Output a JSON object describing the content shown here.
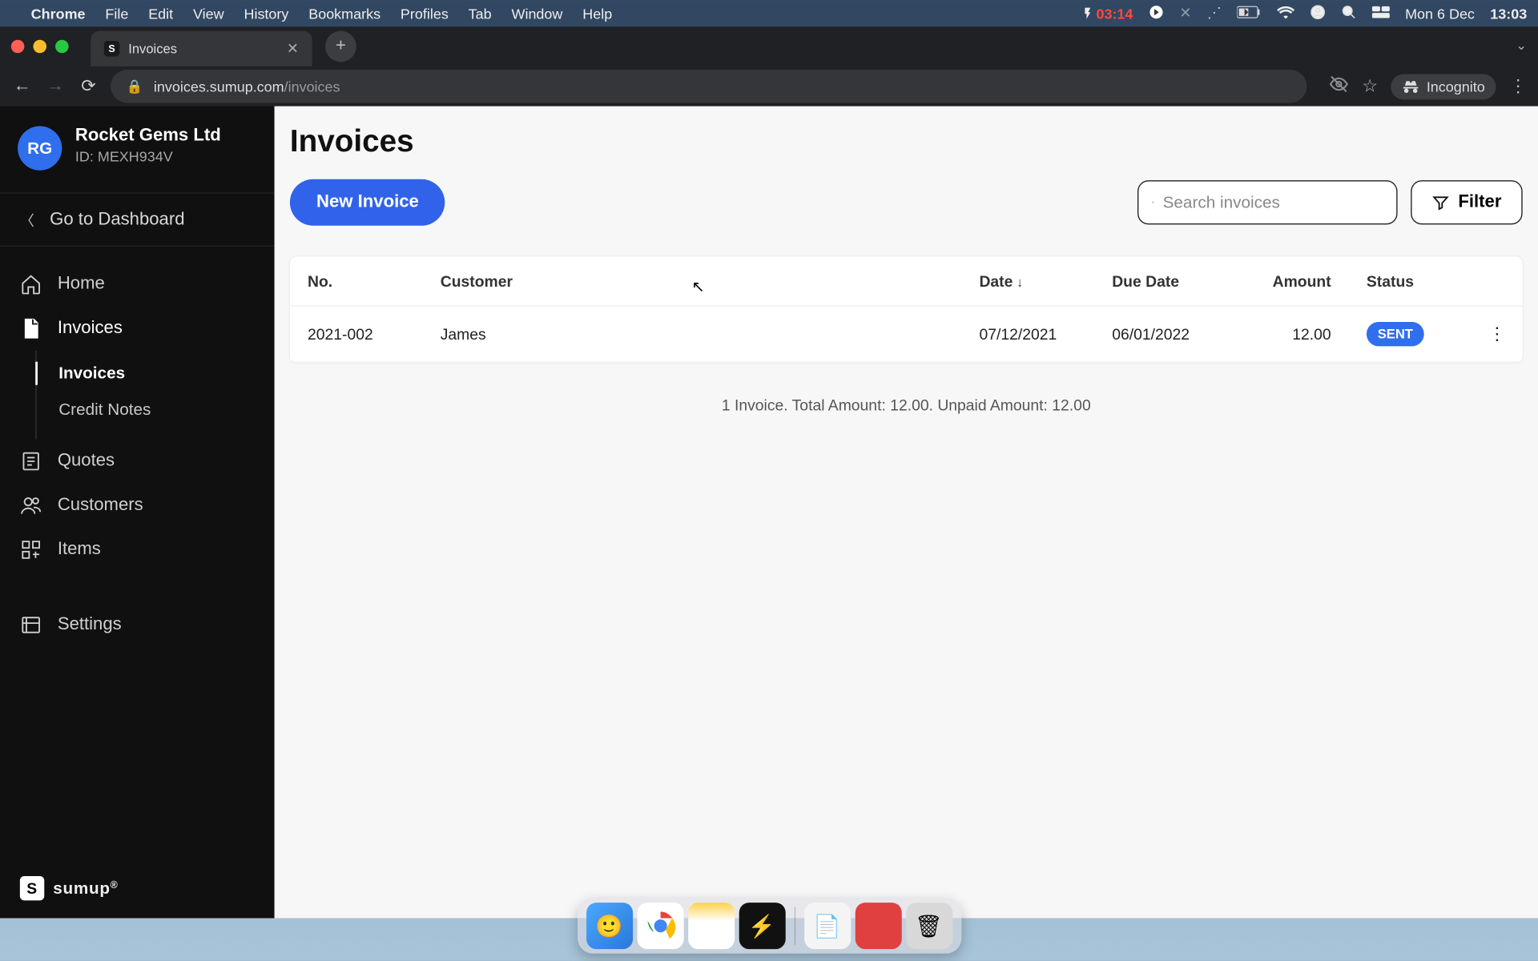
{
  "mac_menu": {
    "app": "Chrome",
    "items": [
      "File",
      "Edit",
      "View",
      "History",
      "Bookmarks",
      "Profiles",
      "Tab",
      "Window",
      "Help"
    ],
    "battery_time": "03:14",
    "date": "Mon 6 Dec",
    "clock": "13:03"
  },
  "browser": {
    "tab_title": "Invoices",
    "url_host": "invoices.sumup.com",
    "url_path": "/invoices",
    "incognito_label": "Incognito"
  },
  "sidebar": {
    "avatar_initials": "RG",
    "company_name": "Rocket Gems Ltd",
    "company_id": "ID: MEXH934V",
    "go_dashboard": "Go to Dashboard",
    "items": [
      {
        "label": "Home"
      },
      {
        "label": "Invoices"
      },
      {
        "label": "Quotes"
      },
      {
        "label": "Customers"
      },
      {
        "label": "Items"
      },
      {
        "label": "Settings"
      }
    ],
    "sub_invoices": {
      "invoices": "Invoices",
      "credit_notes": "Credit Notes"
    },
    "brand": "sumup"
  },
  "page": {
    "title": "Invoices",
    "new_invoice": "New Invoice",
    "search_placeholder": "Search invoices",
    "filter": "Filter"
  },
  "table": {
    "headers": {
      "no": "No.",
      "customer": "Customer",
      "date": "Date",
      "due_date": "Due Date",
      "amount": "Amount",
      "status": "Status"
    },
    "rows": [
      {
        "no": "2021-002",
        "customer": "James",
        "date": "07/12/2021",
        "due_date": "06/01/2022",
        "amount": "12.00",
        "status": "SENT"
      }
    ],
    "summary": "1 Invoice. Total Amount: 12.00. Unpaid Amount: 12.00"
  }
}
